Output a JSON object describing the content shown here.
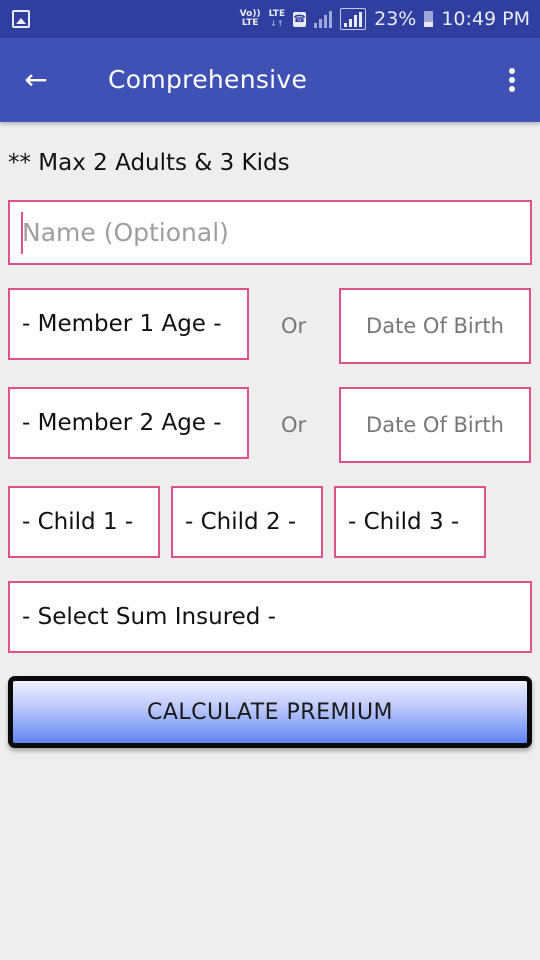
{
  "status_bar": {
    "left_icon": "gallery-icon",
    "volte_label_top": "Vo))",
    "volte_label_bottom": "LTE",
    "lte_label": "LTE",
    "lte_arrows": "↓↑",
    "phone_icon": "☎",
    "battery_percent": "23%",
    "time": "10:49 PM"
  },
  "app_bar": {
    "back_icon": "←",
    "title": "Comprehensive",
    "overflow_icon": "more-vert-icon"
  },
  "form": {
    "note": "** Max 2 Adults & 3 Kids",
    "name_placeholder": "Name (Optional)",
    "name_value": "",
    "member1_age": "- Member 1 Age -",
    "member2_age": "- Member 2 Age -",
    "or_label": "Or",
    "dob_placeholder": "Date Of Birth",
    "children": [
      "- Child 1 -",
      "- Child 2 -",
      "- Child 3 -"
    ],
    "sum_insured": "- Select Sum Insured -",
    "calculate_label": "CALCULATE PREMIUM"
  },
  "colors": {
    "status_bar": "#303f9f",
    "app_bar": "#3f51b5",
    "field_border": "#e0508a",
    "background": "#eeeeee"
  }
}
